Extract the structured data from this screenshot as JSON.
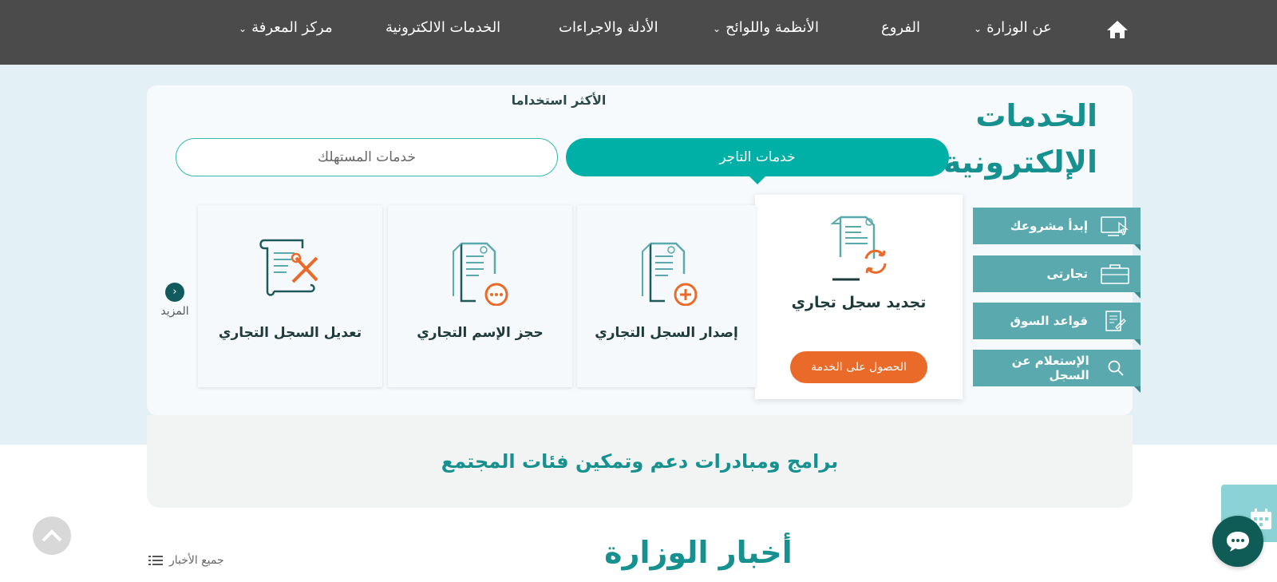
{
  "nav": {
    "items": [
      {
        "label": "عن الوزارة",
        "has_dropdown": true
      },
      {
        "label": "الفروع",
        "has_dropdown": false
      },
      {
        "label": "الأنظمة واللوائح",
        "has_dropdown": true
      },
      {
        "label": "الأدلة والاجراءات",
        "has_dropdown": false
      },
      {
        "label": "الخدمات الالكترونية",
        "has_dropdown": false
      },
      {
        "label": "مركز المعرفة",
        "has_dropdown": true
      }
    ]
  },
  "eservices": {
    "title_line1": "الخدمات",
    "title_line2": "الإلكترونية",
    "most_used": "الأكثر استخداما",
    "tabs": [
      {
        "label": "خدمات التاجر",
        "active": true
      },
      {
        "label": "خدمات المستهلك",
        "active": false
      }
    ],
    "side_buttons": [
      {
        "label": "إبدأ مشروعك",
        "icon": "monitor-cursor-icon"
      },
      {
        "label": "تجارتى",
        "icon": "briefcase-icon"
      },
      {
        "label": "قواعد السوق",
        "icon": "document-pen-icon"
      },
      {
        "label": "الإستعلام عن السجل",
        "icon": "search-icon"
      }
    ],
    "cards": [
      {
        "label": "تجديد سجل تجاري",
        "icon": "renew-document-icon",
        "active": true,
        "cta": "الحصول على الخدمة"
      },
      {
        "label": "إصدار السجل التجاري",
        "icon": "issue-document-icon"
      },
      {
        "label": "حجز الإسم التجاري",
        "icon": "reserve-name-icon"
      },
      {
        "label": "تعديل السجل التجاري",
        "icon": "edit-scroll-icon"
      }
    ],
    "more_label": "المزيد"
  },
  "programs": {
    "label": "برامج ومبادرات دعم وتمكين فئات المجتمع"
  },
  "news": {
    "title": "أخبار الوزارة",
    "all_news": "جميع الأخبار"
  },
  "colors": {
    "teal": "#16918f",
    "tab_active": "#00b0a6",
    "orange": "#ea6a2a",
    "topbar": "#4b4b4b",
    "side_btn": "#5aa9ae"
  }
}
